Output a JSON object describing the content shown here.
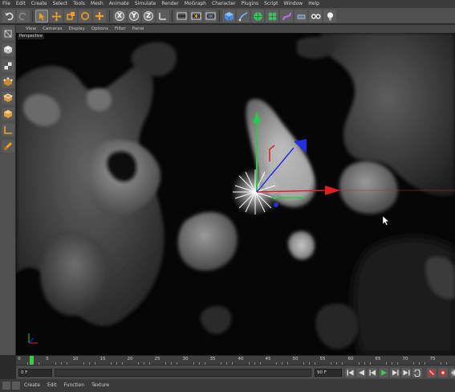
{
  "menubar": {
    "items": [
      "File",
      "Edit",
      "Create",
      "Select",
      "Tools",
      "Mesh",
      "Animate",
      "Simulate",
      "Render",
      "MoGraph",
      "Character",
      "Plugins",
      "Script",
      "Window",
      "Help"
    ]
  },
  "toolbar": {
    "axis_x": "X",
    "axis_y": "Y",
    "axis_z": "Z"
  },
  "viewport_menu": {
    "items": [
      "View",
      "Cameras",
      "Display",
      "Options",
      "Filter",
      "Panel"
    ]
  },
  "viewport": {
    "label": "Perspective"
  },
  "timeline": {
    "ticks": [
      "0",
      "5",
      "10",
      "15",
      "20",
      "25",
      "30",
      "35",
      "40",
      "45",
      "50",
      "55",
      "60",
      "65",
      "70",
      "75"
    ],
    "current_frame": "0"
  },
  "transport": {
    "start_field": "0 F",
    "end_field": "90 F"
  },
  "bottom_menu": {
    "items": [
      "Create",
      "Edit",
      "Function",
      "Texture"
    ]
  },
  "colors": {
    "axis_x": "#e02020",
    "axis_y": "#20d040",
    "axis_z": "#2030e0",
    "accent_orange": "#f0a020"
  }
}
